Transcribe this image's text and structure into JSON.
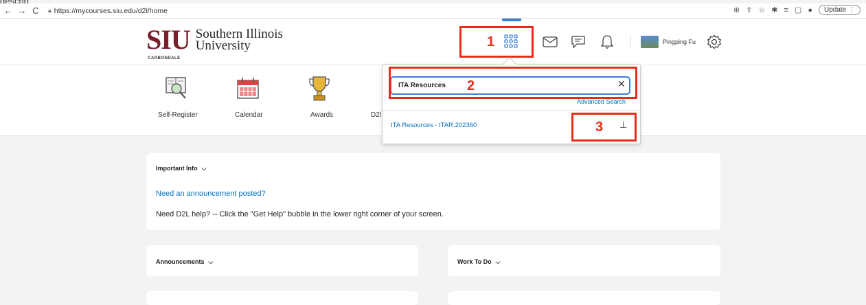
{
  "top_cut_text": "describ",
  "browser": {
    "url": "https://mycourses.siu.edu/d2l/home",
    "update_label": "Update"
  },
  "logo": {
    "siu": "SIU",
    "line1": "Southern Illinois",
    "line2": "University",
    "sub": "CARBONDALE"
  },
  "header": {
    "user_name": "Pingping Fu"
  },
  "annotations": [
    "1",
    "2",
    "3"
  ],
  "nav_items": [
    "Self-Register",
    "Calendar",
    "Awards",
    "D2l"
  ],
  "dropdown": {
    "search_value": "ITA Resources",
    "advanced_search": "Advanced Search",
    "result": "ITA Resources - ITAR.202360"
  },
  "widgets": {
    "important_title": "Important Info",
    "announcement_link": "Need an announcement posted?",
    "help_text": "Need D2L help? -- Click the \"Get Help\" bubble in the lower right corner of your screen.",
    "announcements_title": "Announcements",
    "work_to_do_title": "Work To Do"
  }
}
